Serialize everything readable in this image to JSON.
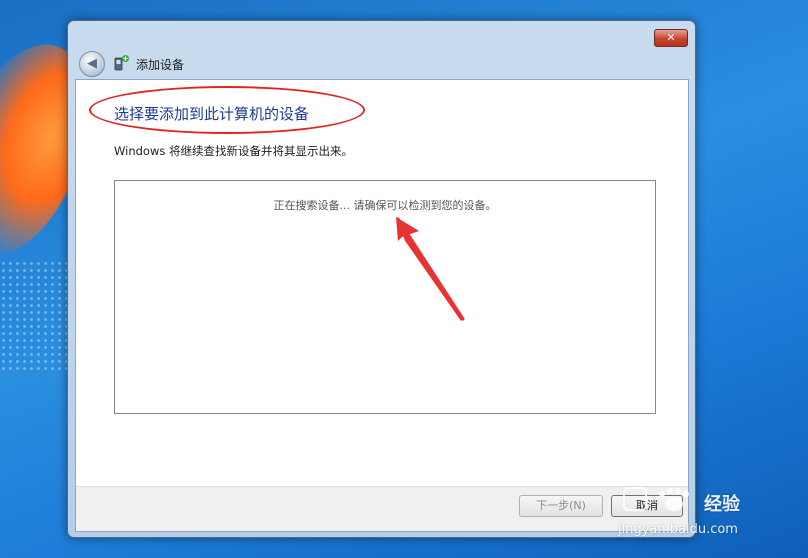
{
  "window": {
    "nav_title": "添加设备",
    "close_glyph": "✕"
  },
  "content": {
    "headline": "选择要添加到此计算机的设备",
    "subtitle": "Windows 将继续查找新设备并将其显示出来。",
    "search_status": "正在搜索设备... 请确保可以检测到您的设备。"
  },
  "footer": {
    "next_label": "下一步(N)",
    "cancel_label": "取消"
  },
  "watermark": {
    "brand": "经验",
    "url": "jingyan.baidu.com"
  },
  "icons": {
    "back": "back-arrow-icon",
    "device": "add-device-icon",
    "close": "close-icon"
  },
  "colors": {
    "headline": "#1c3d8f",
    "annotation": "#e22424",
    "desktop": "#1b7ad6"
  }
}
